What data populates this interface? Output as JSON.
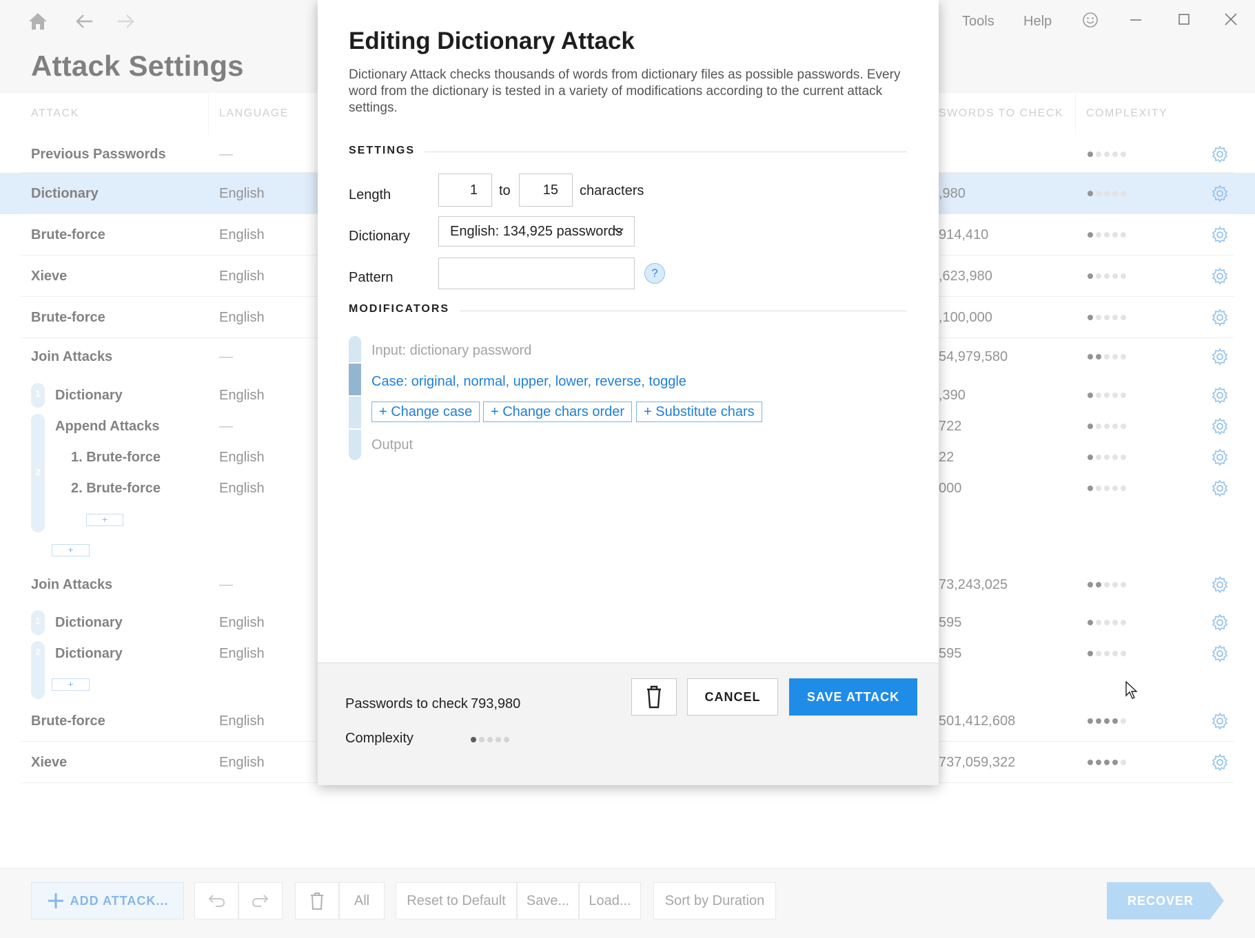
{
  "app": {
    "page_title": "Attack Settings",
    "menu": [
      "Tools",
      "Help"
    ],
    "icons": [
      "home-icon",
      "back-arrow-icon",
      "forward-arrow-icon",
      "smiley-icon",
      "minimize-icon",
      "maximize-icon",
      "close-icon"
    ],
    "columns": {
      "attack": "ATTACK",
      "language": "LANGUAGE",
      "passwords": "SWORDS TO CHECK",
      "complexity": "COMPLEXITY"
    },
    "rows": [
      {
        "name": "Previous Passwords",
        "lang": "—",
        "count": "",
        "complexity": 1
      },
      {
        "name": "Dictionary",
        "lang": "English",
        "count": ",980",
        "complexity": 1,
        "selected": true
      },
      {
        "name": "Brute-force",
        "lang": "English",
        "count": "914,410",
        "complexity": 1
      },
      {
        "name": "Xieve",
        "lang": "English",
        "count": ",623,980",
        "complexity": 1
      },
      {
        "name": "Brute-force",
        "lang": "English",
        "count": ",100,000",
        "complexity": 1
      },
      {
        "name": "Join Attacks",
        "lang": "—",
        "count": "54,979,580",
        "complexity": 2
      },
      {
        "name": "Dictionary",
        "lang": "English",
        "count": ",390",
        "complexity": 1
      },
      {
        "name": "Append Attacks",
        "lang": "—",
        "count": "722",
        "complexity": 1
      },
      {
        "name": "1. Brute-force",
        "lang": "English",
        "count": "22",
        "complexity": 1
      },
      {
        "name": "2. Brute-force",
        "lang": "English",
        "count": "000",
        "complexity": 1
      },
      {
        "name": "Join Attacks",
        "lang": "—",
        "count": "73,243,025",
        "complexity": 2
      },
      {
        "name": "Dictionary",
        "lang": "English",
        "count": "595",
        "complexity": 1
      },
      {
        "name": "Dictionary",
        "lang": "English",
        "count": "595",
        "complexity": 1
      },
      {
        "name": "Brute-force",
        "lang": "English",
        "count": "501,412,608",
        "complexity": 4
      },
      {
        "name": "Xieve",
        "lang": "English",
        "count": "737,059,322",
        "complexity": 4
      }
    ],
    "join_numbers": [
      "1",
      "2",
      "1",
      "2"
    ],
    "plus_label": "+",
    "bottom": {
      "add_attack": "ADD ATTACK...",
      "all": "All",
      "reset": "Reset to Default",
      "save": "Save...",
      "load": "Load...",
      "sort": "Sort by Duration",
      "recover": "RECOVER"
    }
  },
  "dialog": {
    "title": "Editing Dictionary Attack",
    "description": "Dictionary Attack checks thousands of words from dictionary files as possible passwords. Every word from the dictionary is tested in a variety of modifications according to the current attack settings.",
    "settings_header": "SETTINGS",
    "length_label": "Length",
    "length_min": "1",
    "length_to": "to",
    "length_max": "15",
    "length_unit": "characters",
    "dictionary_label": "Dictionary",
    "dictionary_value": "English: 134,925 passwords",
    "pattern_label": "Pattern",
    "pattern_value": "",
    "help": "?",
    "modificators_header": "MODIFICATORS",
    "mod_input": "Input: dictionary password",
    "mod_case": "Case: original, normal, upper, lower, reverse, toggle",
    "mod_add": [
      "+ Change case",
      "+ Change chars order",
      "+ Substitute chars"
    ],
    "mod_output": "Output",
    "passwords_label": "Passwords to check",
    "passwords_value": "793,980",
    "complexity_label": "Complexity",
    "complexity_level": 1,
    "cancel": "CANCEL",
    "save": "SAVE ATTACK"
  },
  "colors": {
    "accent": "#1f8ce8",
    "selected_row": "#cfe3f7",
    "link": "#1f7fd6"
  }
}
